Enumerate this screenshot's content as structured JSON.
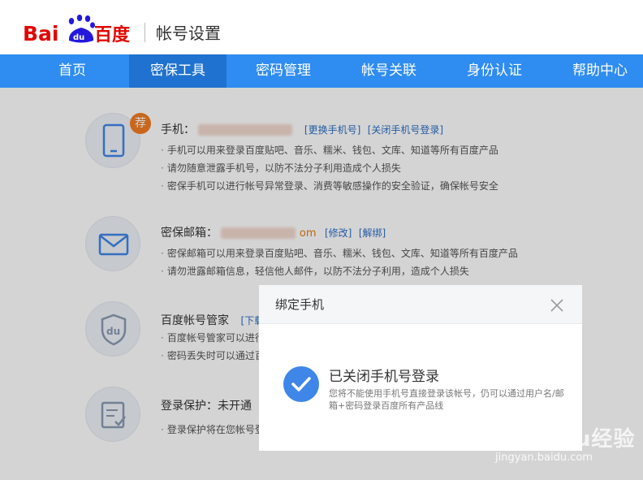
{
  "header": {
    "logo_text": "Baidu百度",
    "title": "帐号设置"
  },
  "nav": {
    "items": [
      {
        "label": "首页"
      },
      {
        "label": "密保工具"
      },
      {
        "label": "密码管理"
      },
      {
        "label": "帐号关联"
      },
      {
        "label": "身份认证"
      },
      {
        "label": "帮助中心"
      }
    ],
    "active_index": 1
  },
  "sections": {
    "phone": {
      "badge": "荐",
      "label": "手机：",
      "link_change": "[更换手机号]",
      "link_close": "[关闭手机号登录]",
      "bullets": [
        "手机可以用来登录百度贴吧、音乐、糯米、钱包、文库、知道等所有百度产品",
        "请勿随意泄露手机号，以防不法分子利用造成个人损失",
        "密保手机可以进行帐号异常登录、消费等敏感操作的安全验证，确保帐号安全"
      ]
    },
    "email": {
      "label": "密保邮箱：",
      "suffix": "om",
      "link_edit": "[修改]",
      "link_unbind": "[解绑]",
      "bullets": [
        "密保邮箱可以用来登录百度贴吧、音乐、糯米、钱包、文库、知道等所有百度产品",
        "请勿泄露邮箱信息，轻信他人邮件，以防不法分子利用，造成个人损失"
      ]
    },
    "manager": {
      "label": "百度帐号管家",
      "link_download": "[下载",
      "bullets": [
        "百度帐号管家可以进行",
        "密码丢失时可以通过百"
      ]
    },
    "protect": {
      "label": "登录保护：未开通",
      "bullets": [
        "登录保护将在您帐号登"
      ]
    }
  },
  "dialog": {
    "title": "绑定手机",
    "message": "已关闭手机号登录",
    "sub": "您将不能使用手机号直接登录该帐号，仍可以通过用户名/邮箱+密码登录百度所有产品线"
  },
  "watermark": {
    "text": "Baidu经验",
    "url": "jingyan.baidu.com"
  },
  "colors": {
    "nav_bg": "#2f8cf1",
    "nav_active": "#1f72cf",
    "badge": "#f27c22",
    "link": "#2d6fc6",
    "check": "#3e86e8"
  }
}
